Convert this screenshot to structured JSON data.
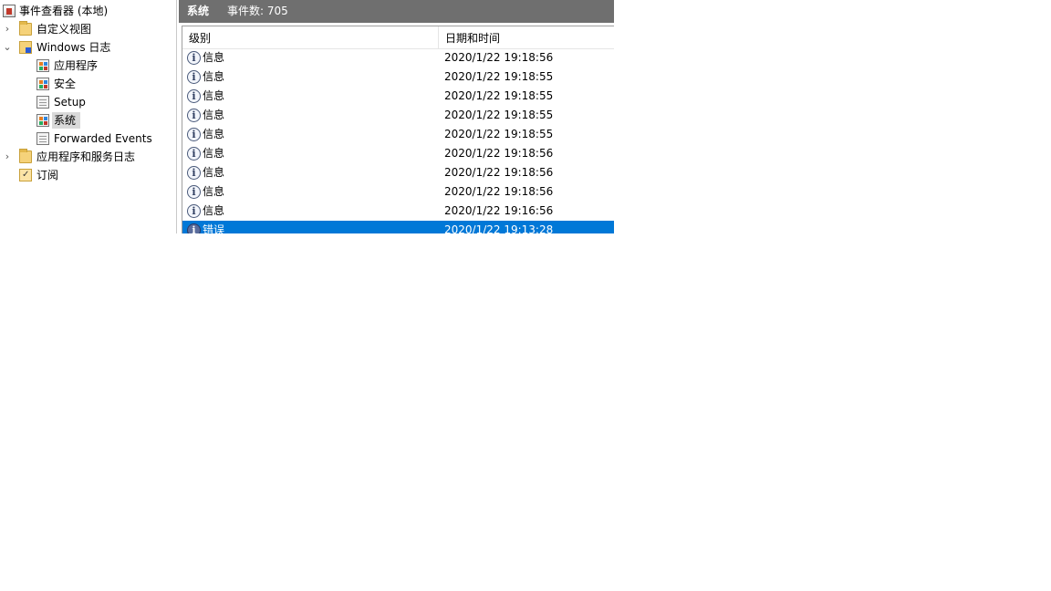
{
  "tree": {
    "root": {
      "label": "事件查看器 (本地)",
      "icon": "event-viewer-icon"
    },
    "items": [
      {
        "label": "自定义视图",
        "icon": "folder-icon",
        "expander": "›"
      },
      {
        "label": "Windows 日志",
        "icon": "folder-icon",
        "expander": "⌄"
      },
      {
        "label": "应用程序",
        "icon": "event-log-icon"
      },
      {
        "label": "安全",
        "icon": "event-log-icon"
      },
      {
        "label": "Setup",
        "icon": "log-icon"
      },
      {
        "label": "系统",
        "icon": "event-log-icon",
        "selected": true
      },
      {
        "label": "Forwarded Events",
        "icon": "log-icon"
      },
      {
        "label": "应用程序和服务日志",
        "icon": "folder-icon",
        "expander": "›"
      },
      {
        "label": "订阅",
        "icon": "subscription-icon"
      }
    ]
  },
  "pane": {
    "title": "系统",
    "count": "事件数: 705"
  },
  "grid": {
    "columns": [
      "级别",
      "日期和时间"
    ],
    "rows": [
      {
        "level": "信息",
        "date": "2020/1/22 19:18:56",
        "icon": "info-icon"
      },
      {
        "level": "信息",
        "date": "2020/1/22 19:18:55",
        "icon": "info-icon"
      },
      {
        "level": "信息",
        "date": "2020/1/22 19:18:55",
        "icon": "info-icon"
      },
      {
        "level": "信息",
        "date": "2020/1/22 19:18:55",
        "icon": "info-icon"
      },
      {
        "level": "信息",
        "date": "2020/1/22 19:18:55",
        "icon": "info-icon"
      },
      {
        "level": "信息",
        "date": "2020/1/22 19:18:56",
        "icon": "info-icon"
      },
      {
        "level": "信息",
        "date": "2020/1/22 19:18:56",
        "icon": "info-icon"
      },
      {
        "level": "信息",
        "date": "2020/1/22 19:18:56",
        "icon": "info-icon"
      },
      {
        "level": "信息",
        "date": "2020/1/22 19:16:56",
        "icon": "info-icon"
      },
      {
        "level": "错误",
        "date": "2020/1/22 19:13:28",
        "icon": "info-icon",
        "selected": true
      }
    ],
    "info_glyph": "i"
  },
  "colors": {
    "titlebar": "#6f6f6f",
    "selection": "#0078d7",
    "tree_selection": "#d9d9d9"
  }
}
